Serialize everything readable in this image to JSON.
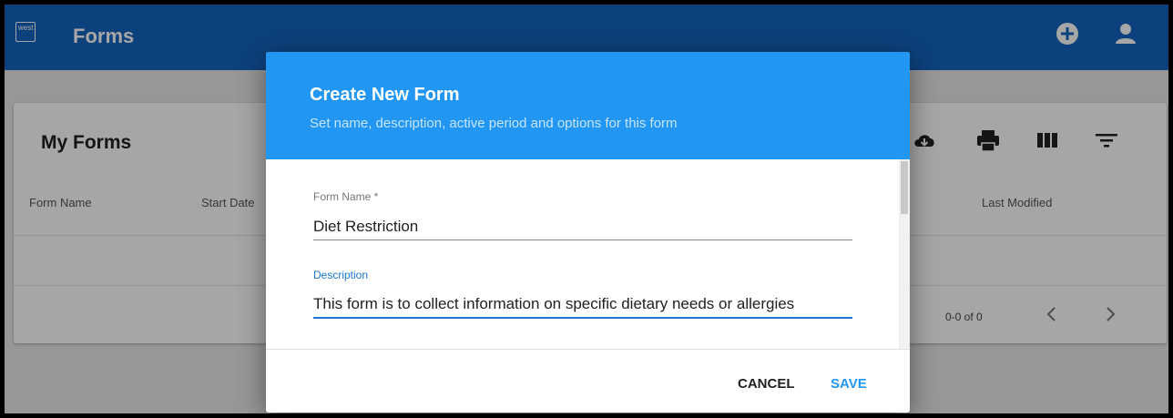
{
  "app": {
    "logo_text": "west",
    "title": "Forms",
    "colors": {
      "appbar": "#1565c0",
      "dialog_header": "#2196f3",
      "accent": "#1976d2"
    }
  },
  "appbar_icons": [
    "add-circle-icon",
    "account-icon"
  ],
  "card": {
    "title": "My Forms",
    "toolbar_icons": [
      "cloud-download-icon",
      "print-icon",
      "view-columns-icon",
      "filter-icon"
    ],
    "columns": {
      "form_name": "Form Name",
      "start_date": "Start Date",
      "last_modified": "Last Modified"
    },
    "pagination": {
      "text": "0-0 of 0"
    }
  },
  "dialog": {
    "title": "Create New Form",
    "subtitle": "Set name, description, active period and options for this form",
    "fields": {
      "name_label": "Form Name *",
      "name_value": "Diet Restriction",
      "description_label": "Description",
      "description_value": "This form is to collect information on specific dietary needs or allergies"
    },
    "actions": {
      "cancel": "CANCEL",
      "save": "SAVE"
    }
  }
}
